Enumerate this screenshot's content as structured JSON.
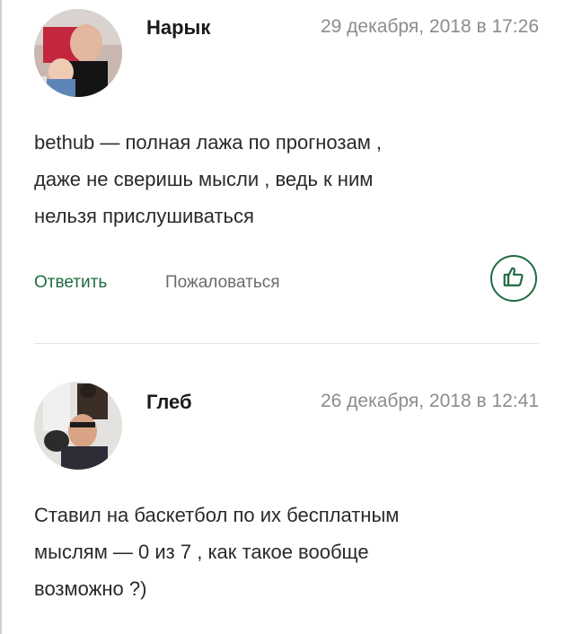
{
  "comments": [
    {
      "author": "Нарык",
      "date": "29 декабря, 2018 в 17:26",
      "text_lines": [
        "bethub — полная лажа по прогнозам ,",
        "даже не сверишь мысли , ведь к ним",
        "нельзя прислушиваться"
      ],
      "reply_label": "Ответить",
      "complain_label": "Пожаловаться"
    },
    {
      "author": "Глеб",
      "date": "26 декабря, 2018 в 12:41",
      "text_lines": [
        "Ставил на баскетбол по их бесплатным",
        "мыслям — 0 из 7 , как такое вообще",
        "возможно ?)"
      ]
    }
  ],
  "colors": {
    "accent": "#1e6b41",
    "date": "#8c8c8c"
  },
  "icons": {
    "like": "thumbs-up-icon"
  }
}
